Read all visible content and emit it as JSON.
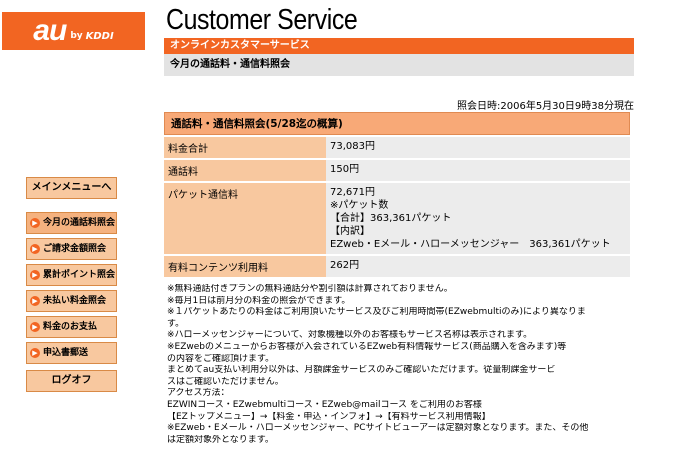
{
  "logo": {
    "au": "au",
    "by": "by",
    "kddi": "KDDI"
  },
  "header": {
    "title": "Customer Service",
    "subtitle": "オンラインカスタマーサービス",
    "page_title": "今月の通話料・通信料照会"
  },
  "sidebar": {
    "main_menu": "メインメニューへ",
    "items": [
      {
        "label": "今月の通話料照会"
      },
      {
        "label": "ご請求金額照会"
      },
      {
        "label": "累計ポイント照会"
      },
      {
        "label": "未払い料金照会"
      },
      {
        "label": "料金のお支払"
      },
      {
        "label": "申込書郵送"
      }
    ],
    "logout": "ログオフ"
  },
  "timestamp": "照会日時:2006年5月30日9時38分現在",
  "fees": {
    "header": "通話料・通信料照会(5/28迄の概算)",
    "rows": [
      {
        "label": "料金合計",
        "lines": [
          "73,083円"
        ]
      },
      {
        "label": "通話料",
        "lines": [
          "150円"
        ]
      },
      {
        "label": "パケット通信料",
        "lines": [
          "72,671円",
          "※パケット数",
          "【合計】363,361パケット",
          "【内訳】",
          "EZweb・Eメール・ハローメッセンジャー　363,361パケット"
        ]
      },
      {
        "label": "有料コンテンツ利用料",
        "lines": [
          "262円"
        ]
      }
    ]
  },
  "notes": [
    "※無料通話付きプランの無料通話分や割引額は計算されておりません。",
    "※毎月1日は前月分の料金の照会ができます。",
    "※１パケットあたりの料金はご利用頂いたサービス及びご利用時間帯(EZwebmultiのみ)により異なりま",
    "す。",
    "※ハローメッセンジャーについて、対象機種以外のお客様もサービス名称は表示されます。",
    "※EZwebのメニューからお客様が入会されているEZweb有料情報サービス(商品購入を含みます)等",
    "の内容をご確認頂けます。",
    "まとめてau支払い利用分以外は、月額課金サービスのみご確認いただけます。従量制課金サービ",
    "スはご確認いただけません。",
    "アクセス方法：",
    "EZWINコース・EZwebmultiコース・EZweb@mailコース をご利用のお客様",
    "【EZトップメニュー】→【料金・申込・インフォ】→【有料サービス利用情報】",
    "※EZweb・Eメール・ハローメッセンジャー、PCサイトビューアーは定額対象となります。また、その他",
    "は定額対象外となります。"
  ]
}
